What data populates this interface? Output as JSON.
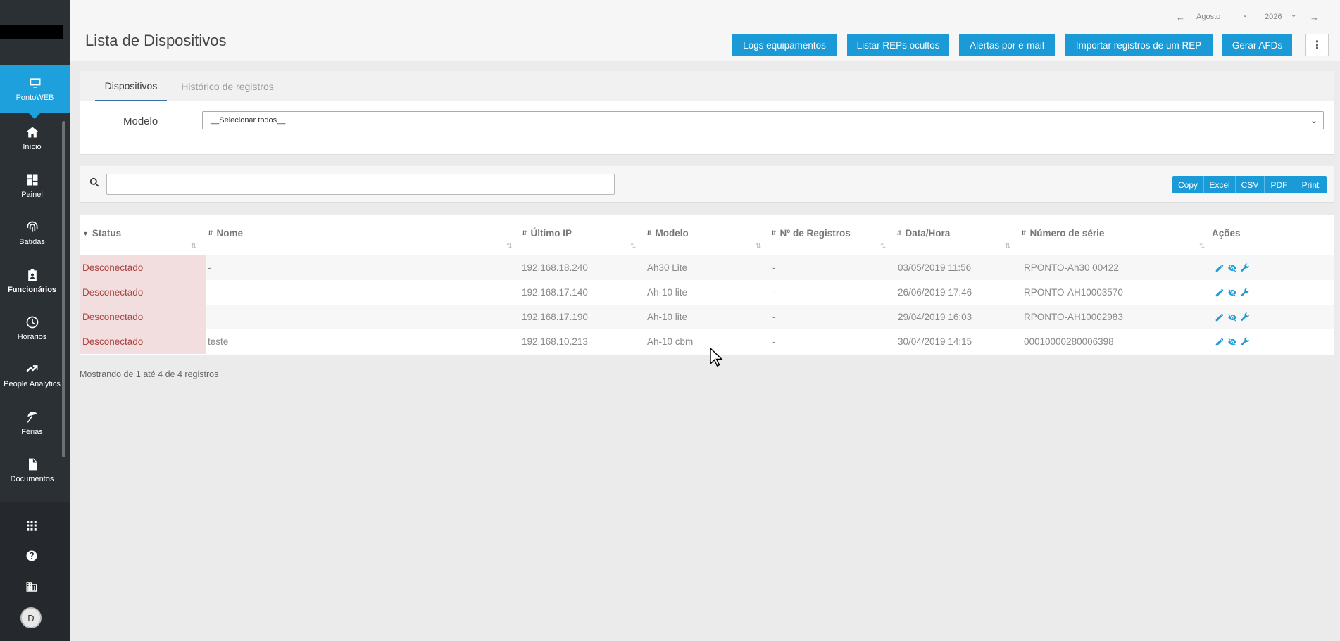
{
  "sidebar": {
    "items": [
      {
        "label": "PontoWEB",
        "icon": "monitor-icon"
      },
      {
        "label": "Início",
        "icon": "home-icon"
      },
      {
        "label": "Painel",
        "icon": "dashboard-icon"
      },
      {
        "label": "Batidas",
        "icon": "fingerprint-icon"
      },
      {
        "label": "Funcionários",
        "icon": "clipboard-user-icon"
      },
      {
        "label": "Horários",
        "icon": "clock-icon"
      },
      {
        "label": "People Analytics",
        "icon": "trending-up-icon"
      },
      {
        "label": "Férias",
        "icon": "beach-umbrella-icon"
      },
      {
        "label": "Documentos",
        "icon": "document-icon"
      }
    ],
    "bottom_icons": [
      "apps-grid-icon",
      "help-icon",
      "company-building-icon"
    ],
    "avatar_initial": "D"
  },
  "header": {
    "title": "Lista de Dispositivos",
    "period": {
      "month": "Agosto",
      "year": "2026"
    },
    "buttons": [
      "Logs equipamentos",
      "Listar REPs ocultos",
      "Alertas por e-mail",
      "Importar registros de um REP",
      "Gerar AFDs"
    ],
    "more_icon": "kebab-menu-icon"
  },
  "tabs": [
    "Dispositivos",
    "Histórico de registros"
  ],
  "filter": {
    "label": "Modelo",
    "selected": "__Selecionar todos__"
  },
  "search": {
    "value": ""
  },
  "export_buttons": [
    "Copy",
    "Excel",
    "CSV",
    "PDF",
    "Print"
  ],
  "table": {
    "columns": [
      "Status",
      "Nome",
      "Último IP",
      "Modelo",
      "Nº de Registros",
      "Data/Hora",
      "Número de série",
      "Ações"
    ],
    "rows": [
      {
        "status": "Desconectado",
        "nome": "-",
        "ip": "192.168.18.240",
        "modelo": "Ah30 Lite",
        "registros": "-",
        "data": "03/05/2019 11:56",
        "serie": "RPONTO-Ah30 00422"
      },
      {
        "status": "Desconectado",
        "nome": "",
        "ip": "192.168.17.140",
        "modelo": "Ah-10 lite",
        "registros": "-",
        "data": "26/06/2019 17:46",
        "serie": "RPONTO-AH10003570"
      },
      {
        "status": "Desconectado",
        "nome": "",
        "ip": "192.168.17.190",
        "modelo": "Ah-10 lite",
        "registros": "-",
        "data": "29/04/2019 16:03",
        "serie": "RPONTO-AH10002983"
      },
      {
        "status": "Desconectado",
        "nome": "teste",
        "ip": "192.168.10.213",
        "modelo": "Ah-10 cbm",
        "registros": "-",
        "data": "30/04/2019 14:15",
        "serie": "00010000280006398"
      }
    ],
    "info": "Mostrando de 1 até 4 de 4 registros"
  },
  "colors": {
    "accent": "#1a9ad6",
    "sidebar": "#2b3035",
    "status_bg": "#f2dede",
    "status_text": "#a94442"
  }
}
